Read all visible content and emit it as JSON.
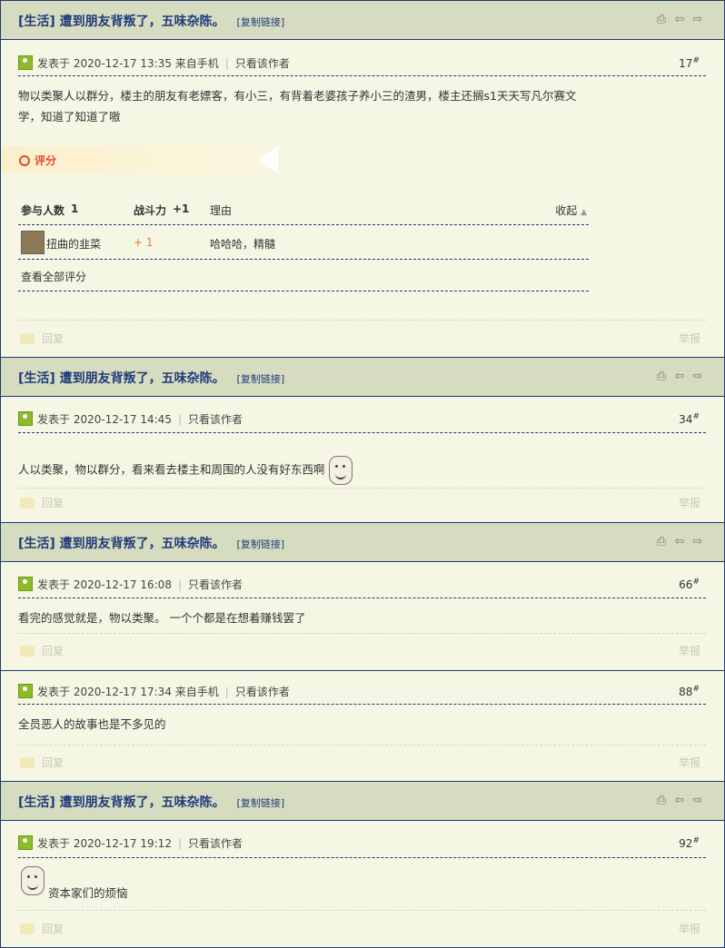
{
  "threadbar": {
    "category": "[生活]",
    "title": "遭到朋友背叛了，五味杂陈。",
    "copy_link": "[复制链接]",
    "icons": [
      "print-icon",
      "prev-icon",
      "next-icon"
    ]
  },
  "posts": [
    {
      "meta": "发表于 2020-12-17 13:35 来自手机",
      "only_author": "只看该作者",
      "floor": "17",
      "floor_mark": "#",
      "text": "物以类聚人以群分，楼主的朋友有老嫖客，有小三，有背着老婆孩子养小三的渣男，楼主还搁s1天天写凡尔赛文学，知道了知道了嗷",
      "rating": {
        "label": "评分",
        "col_participants": "参与人数",
        "participants_count": "1",
        "col_power": "战斗力",
        "power_total": "+1",
        "col_reason": "理由",
        "collapse": "收起",
        "rows": [
          {
            "user": "扭曲的韭菜",
            "power": "+ 1",
            "reason": "哈哈哈，精髓"
          }
        ],
        "view_all": "查看全部评分"
      }
    },
    {
      "meta": "发表于 2020-12-17 14:45",
      "only_author": "只看该作者",
      "floor": "34",
      "floor_mark": "#",
      "text": "人以类聚，物以群分，看来看去楼主和周围的人没有好东西啊"
    },
    {
      "meta": "发表于 2020-12-17 16:08",
      "only_author": "只看该作者",
      "floor": "66",
      "floor_mark": "#",
      "text": "看完的感觉就是，物以类聚。 一个个都是在想着赚钱罢了"
    },
    {
      "meta": "发表于 2020-12-17 17:34 来自手机",
      "only_author": "只看该作者",
      "floor": "88",
      "floor_mark": "#",
      "text": "全员恶人的故事也是不多见的"
    },
    {
      "meta": "发表于 2020-12-17 19:12",
      "only_author": "只看该作者",
      "floor": "92",
      "floor_mark": "#",
      "text": "资本家们的烦恼"
    }
  ],
  "actions": {
    "reply": "回复",
    "report": "举报"
  }
}
